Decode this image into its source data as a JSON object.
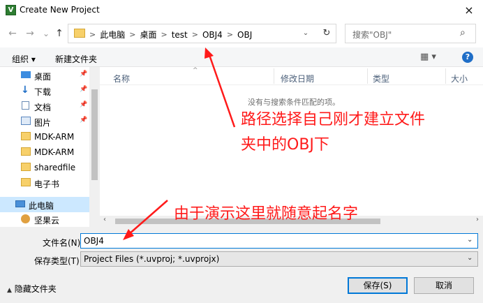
{
  "window": {
    "title": "Create New Project",
    "close_icon": "×",
    "app_icon": "V"
  },
  "nav": {
    "back": "←",
    "forward": "→",
    "recent": "⌄",
    "up": "↑"
  },
  "address": {
    "crumbs": [
      "此电脑",
      "桌面",
      "test",
      "OBJ4",
      "OBJ"
    ],
    "separator": ">",
    "dropdown": "⌄",
    "refresh": "↻"
  },
  "search": {
    "placeholder": "搜索\"OBJ\"",
    "icon": "⌕"
  },
  "toolbar": {
    "organize": "组织 ▾",
    "new_folder": "新建文件夹",
    "view_icon": "▦ ▾",
    "help_icon": "?"
  },
  "sidebar": {
    "items": [
      {
        "label": "桌面",
        "icon": "desktop-icon",
        "pinned": true
      },
      {
        "label": "下载",
        "icon": "download-icon",
        "pinned": true
      },
      {
        "label": "文档",
        "icon": "document-icon",
        "pinned": true
      },
      {
        "label": "图片",
        "icon": "pictures-icon",
        "pinned": true
      },
      {
        "label": "MDK-ARM",
        "icon": "folder-icon",
        "pinned": false
      },
      {
        "label": "MDK-ARM",
        "icon": "folder-icon",
        "pinned": false
      },
      {
        "label": "sharedfile",
        "icon": "folder-icon",
        "pinned": false
      },
      {
        "label": "电子书",
        "icon": "folder-icon",
        "pinned": false
      },
      {
        "label": "此电脑",
        "icon": "computer-icon",
        "pinned": false
      },
      {
        "label": "坚果云",
        "icon": "nutstore-icon",
        "pinned": false
      }
    ],
    "pin_glyph": "📌"
  },
  "filelist": {
    "columns": [
      "名称",
      "修改日期",
      "类型",
      "大小"
    ],
    "empty_message": "没有与搜索条件匹配的项。",
    "sort_indicator": "^"
  },
  "form": {
    "filename_label": "文件名(N):",
    "filename_value": "OBJ4",
    "filetype_label": "保存类型(T):",
    "filetype_value": "Project Files (*.uvproj; *.uvprojx)",
    "dropdown": "⌄"
  },
  "footer": {
    "hide_folders": "隐藏文件夹",
    "hide_icon": "▲",
    "save": "保存(S)",
    "cancel": "取消"
  },
  "annotations": {
    "path_note_line1": "路径选择自己刚才建立文件",
    "path_note_line2": "夹中的OBJ下",
    "name_note": "由于演示这里就随意起名字"
  },
  "colors": {
    "annotation": "#ff1a1a",
    "accent": "#0078d7",
    "selection": "#cce8ff"
  }
}
